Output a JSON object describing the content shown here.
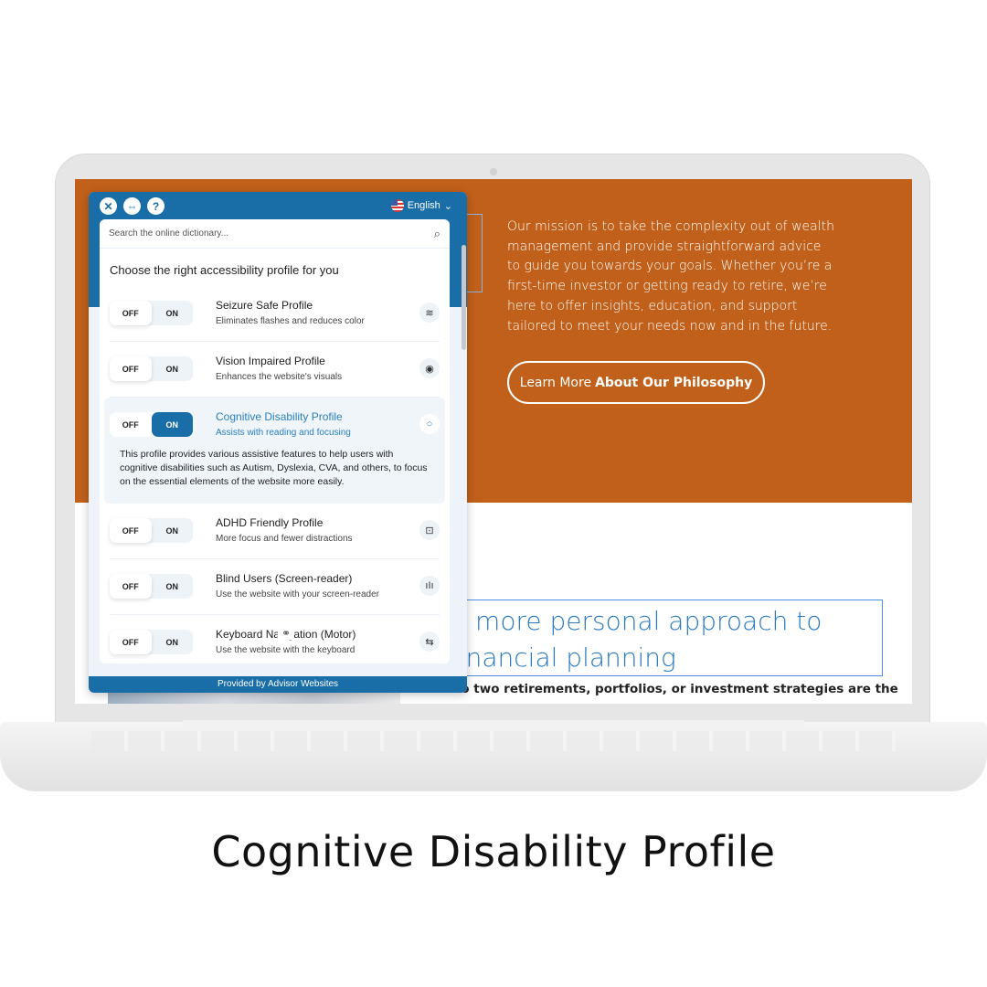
{
  "caption": "Cognitive Disability Profile",
  "site": {
    "mission": "Our mission is to take the complexity out of wealth management and provide straightforward advice to guide you towards your goals. Whether you’re a first-time investor or getting ready to retire, we’re here to offer insights, education, and support tailored to meet your needs now and in the future.",
    "learn_prefix": "Learn More",
    "learn_bold": "About Our Philosophy",
    "heading": "A more personal approach to financial planning",
    "sub": "No two retirements, portfolios, or investment strategies are the",
    "brand_color": "#c1601a"
  },
  "widget": {
    "language": "English",
    "search_placeholder": "Search the online dictionary...",
    "choose": "Choose the right accessibility profile for you",
    "off": "OFF",
    "on": "ON",
    "profiles": [
      {
        "title": "Seizure Safe Profile",
        "desc": "Eliminates flashes and reduces color",
        "icon": "seizure-icon",
        "state": "off"
      },
      {
        "title": "Vision Impaired Profile",
        "desc": "Enhances the website's visuals",
        "icon": "eye-icon",
        "state": "off"
      },
      {
        "title": "Cognitive Disability Profile",
        "desc": "Assists with reading and focusing",
        "icon": "circle-icon",
        "state": "on",
        "long": "This profile provides various assistive features to help users with cognitive disabilities such as Autism, Dyslexia, CVA, and others, to focus on the essential elements of the website more easily."
      },
      {
        "title": "ADHD Friendly Profile",
        "desc": "More focus and fewer distractions",
        "icon": "focus-icon",
        "state": "off"
      },
      {
        "title": "Blind Users (Screen-reader)",
        "desc": "Use the website with your screen-reader",
        "icon": "audio-icon",
        "state": "off"
      },
      {
        "title": "Keyboard Navigation (Motor)",
        "desc": "Use the website with the keyboard",
        "icon": "arrows-icon",
        "state": "off"
      }
    ],
    "footer": "Provided by Advisor Websites",
    "accent": "#1a6ea8"
  }
}
